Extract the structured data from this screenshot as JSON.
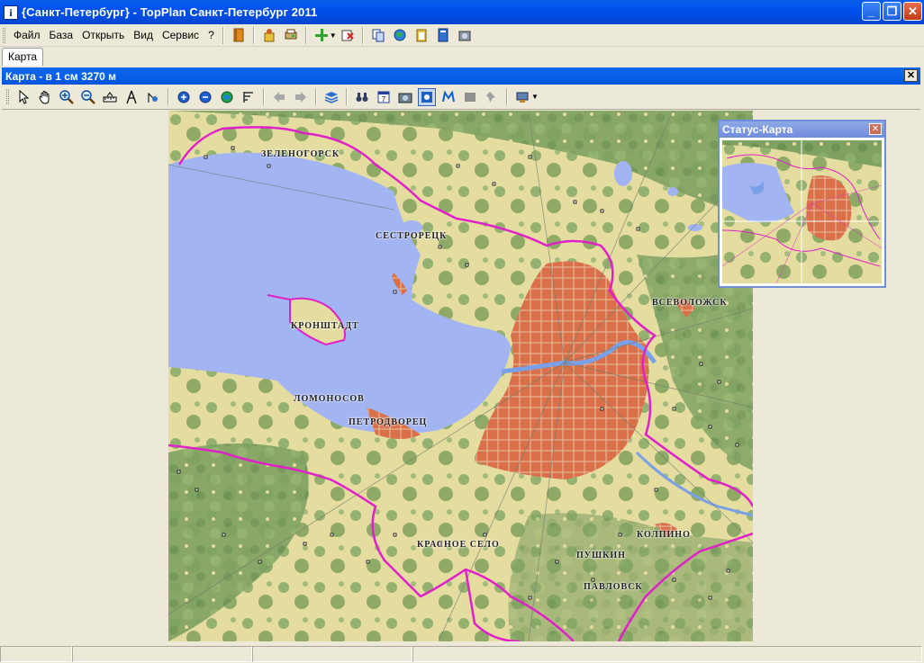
{
  "window": {
    "title": "{Санкт-Петербург} - TopPlan Санкт-Петербург 2011",
    "icon": "info-icon"
  },
  "menu": [
    "Файл",
    "База",
    "Открыть",
    "Вид",
    "Сервис",
    "?"
  ],
  "main_toolbar_icons": [
    "book-icon",
    "wizard-icon",
    "print-icon",
    "add-layer-icon",
    "delete-layer-icon",
    "copy-icon",
    "globe-icon",
    "paste-icon",
    "document-icon",
    "settings-icon"
  ],
  "tabs": [
    {
      "label": "Карта",
      "active": true
    }
  ],
  "map_window": {
    "title": "Карта - в 1 см 3270 м"
  },
  "map_toolbar_icons": [
    "pointer-icon",
    "hand-pan-icon",
    "zoom-in-icon",
    "zoom-out-icon",
    "ruler-icon",
    "compass-icon",
    "measure-icon",
    "plus-circle-icon",
    "minus-circle-icon",
    "globe-icon",
    "scale-icon",
    "back-icon",
    "forward-icon",
    "layers-icon",
    "binoculars-icon",
    "calendar-icon",
    "photo-icon",
    "map-frame-icon",
    "metro-icon",
    "gray-box-icon",
    "pin-icon",
    "export-icon"
  ],
  "map_labels": [
    {
      "text": "ЗЕЛЕНОГОРСК",
      "key": "zelenogorsk"
    },
    {
      "text": "СЕСТРОРЕЦК",
      "key": "sestroretsk"
    },
    {
      "text": "ВСЕВОЛОЖСК",
      "key": "vsevolozhsk"
    },
    {
      "text": "КРОНШТАДТ",
      "key": "kronshtadt"
    },
    {
      "text": "ЛОМОНОСОВ",
      "key": "lomonosov"
    },
    {
      "text": "ПЕТРОДВОРЕЦ",
      "key": "petrodvorets"
    },
    {
      "text": "КРАСНОЕ СЕЛО",
      "key": "krasnoe-selo"
    },
    {
      "text": "КОЛПИНО",
      "key": "kolpino"
    },
    {
      "text": "ПУШКИН",
      "key": "pushkin"
    },
    {
      "text": "ПАВЛОВСК",
      "key": "pavlovsk"
    }
  ],
  "status_map": {
    "title": "Статус-Карта"
  },
  "colors": {
    "water": "#a2b4f2",
    "forest": "#8fae6a",
    "field": "#e8dfa0",
    "urban": "#e07848",
    "boundary": "#e020c8"
  }
}
